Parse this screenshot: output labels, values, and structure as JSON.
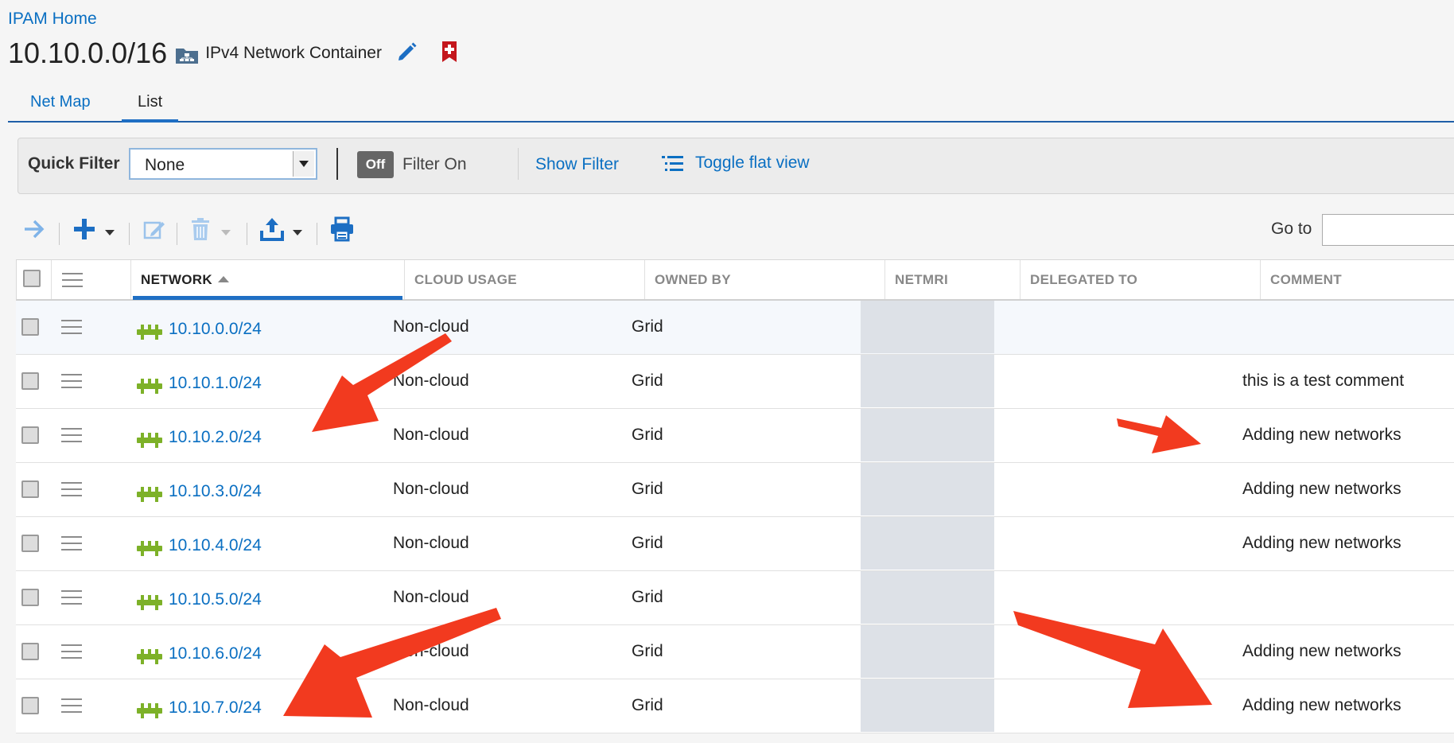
{
  "breadcrumb": {
    "home": "IPAM Home"
  },
  "header": {
    "title": "10.10.0.0/16",
    "type_label": "IPv4 Network Container",
    "icons": [
      "network-container-icon",
      "pencil-edit-icon",
      "bookmark-add-icon"
    ]
  },
  "tabs": [
    {
      "label": "Net Map",
      "active": false
    },
    {
      "label": "List",
      "active": true
    }
  ],
  "filter_bar": {
    "quick_filter_label": "Quick Filter",
    "quick_filter_value": "None",
    "toggle_label": "Off",
    "filter_on_label": "Filter On",
    "show_filter_label": "Show Filter",
    "toggle_flat_view_label": "Toggle flat view"
  },
  "toolbar": {
    "icons": [
      "arrow-right-icon",
      "plus-icon",
      "edit-icon",
      "trash-icon",
      "export-upload-icon",
      "print-icon"
    ],
    "goto_label": "Go to",
    "goto_value": ""
  },
  "table": {
    "columns": [
      "NETWORK",
      "CLOUD USAGE",
      "OWNED BY",
      "NETMRI",
      "DELEGATED TO",
      "COMMENT"
    ],
    "sorted_column": "NETWORK",
    "sort_direction": "ascending",
    "rows": [
      {
        "network": "10.10.0.0/24",
        "cloud_usage": "Non-cloud",
        "owned_by": "Grid",
        "netmri": "",
        "delegated_to": "",
        "comment": ""
      },
      {
        "network": "10.10.1.0/24",
        "cloud_usage": "Non-cloud",
        "owned_by": "Grid",
        "netmri": "",
        "delegated_to": "",
        "comment": "this is a test comment"
      },
      {
        "network": "10.10.2.0/24",
        "cloud_usage": "Non-cloud",
        "owned_by": "Grid",
        "netmri": "",
        "delegated_to": "",
        "comment": "Adding new networks"
      },
      {
        "network": "10.10.3.0/24",
        "cloud_usage": "Non-cloud",
        "owned_by": "Grid",
        "netmri": "",
        "delegated_to": "",
        "comment": "Adding new networks"
      },
      {
        "network": "10.10.4.0/24",
        "cloud_usage": "Non-cloud",
        "owned_by": "Grid",
        "netmri": "",
        "delegated_to": "",
        "comment": "Adding new networks"
      },
      {
        "network": "10.10.5.0/24",
        "cloud_usage": "Non-cloud",
        "owned_by": "Grid",
        "netmri": "",
        "delegated_to": "",
        "comment": ""
      },
      {
        "network": "10.10.6.0/24",
        "cloud_usage": "Non-cloud",
        "owned_by": "Grid",
        "netmri": "",
        "delegated_to": "",
        "comment": "Adding new networks"
      },
      {
        "network": "10.10.7.0/24",
        "cloud_usage": "Non-cloud",
        "owned_by": "Grid",
        "netmri": "",
        "delegated_to": "",
        "comment": "Adding new networks"
      }
    ]
  },
  "colors": {
    "link": "#0a6fc2",
    "accent": "#1f6fc4",
    "network_icon": "#7db128",
    "annotation_arrow": "#f23a1f",
    "netmri_cell": "#dde1e7"
  }
}
